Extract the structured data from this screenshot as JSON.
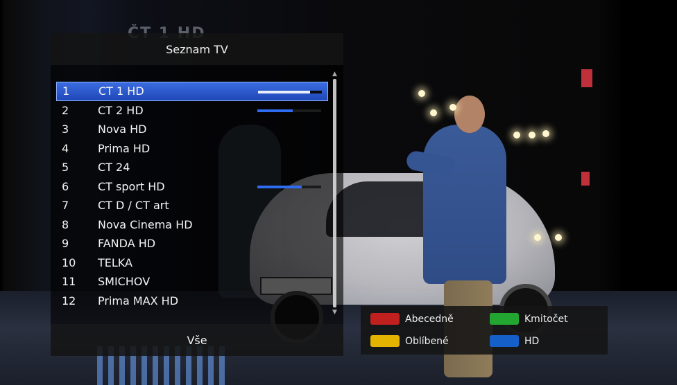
{
  "logo_text": "ČT 1 HD",
  "panel": {
    "title": "Seznam TV",
    "footer": "Vše",
    "channels": [
      {
        "num": "1",
        "name": "CT 1 HD",
        "signal": 0.82,
        "selected": true
      },
      {
        "num": "2",
        "name": "CT 2 HD",
        "signal": 0.55
      },
      {
        "num": "3",
        "name": "Nova HD"
      },
      {
        "num": "4",
        "name": "Prima HD"
      },
      {
        "num": "5",
        "name": "CT 24"
      },
      {
        "num": "6",
        "name": "CT sport HD",
        "signal": 0.7
      },
      {
        "num": "7",
        "name": "CT D / CT art"
      },
      {
        "num": "8",
        "name": "Nova Cinema HD"
      },
      {
        "num": "9",
        "name": "FANDA HD"
      },
      {
        "num": "10",
        "name": "TELKA"
      },
      {
        "num": "11",
        "name": "SMICHOV"
      },
      {
        "num": "12",
        "name": "Prima MAX HD"
      }
    ]
  },
  "legend": {
    "red": {
      "label": "Abecedně",
      "color": "#c0201e"
    },
    "green": {
      "label": "Kmitočet",
      "color": "#22a531"
    },
    "yellow": {
      "label": "Oblíbené",
      "color": "#e2b300"
    },
    "blue": {
      "label": "HD",
      "color": "#1560c8"
    }
  },
  "icons": {
    "scroll_up": "arrow-up-icon",
    "scroll_down": "arrow-down-icon"
  }
}
